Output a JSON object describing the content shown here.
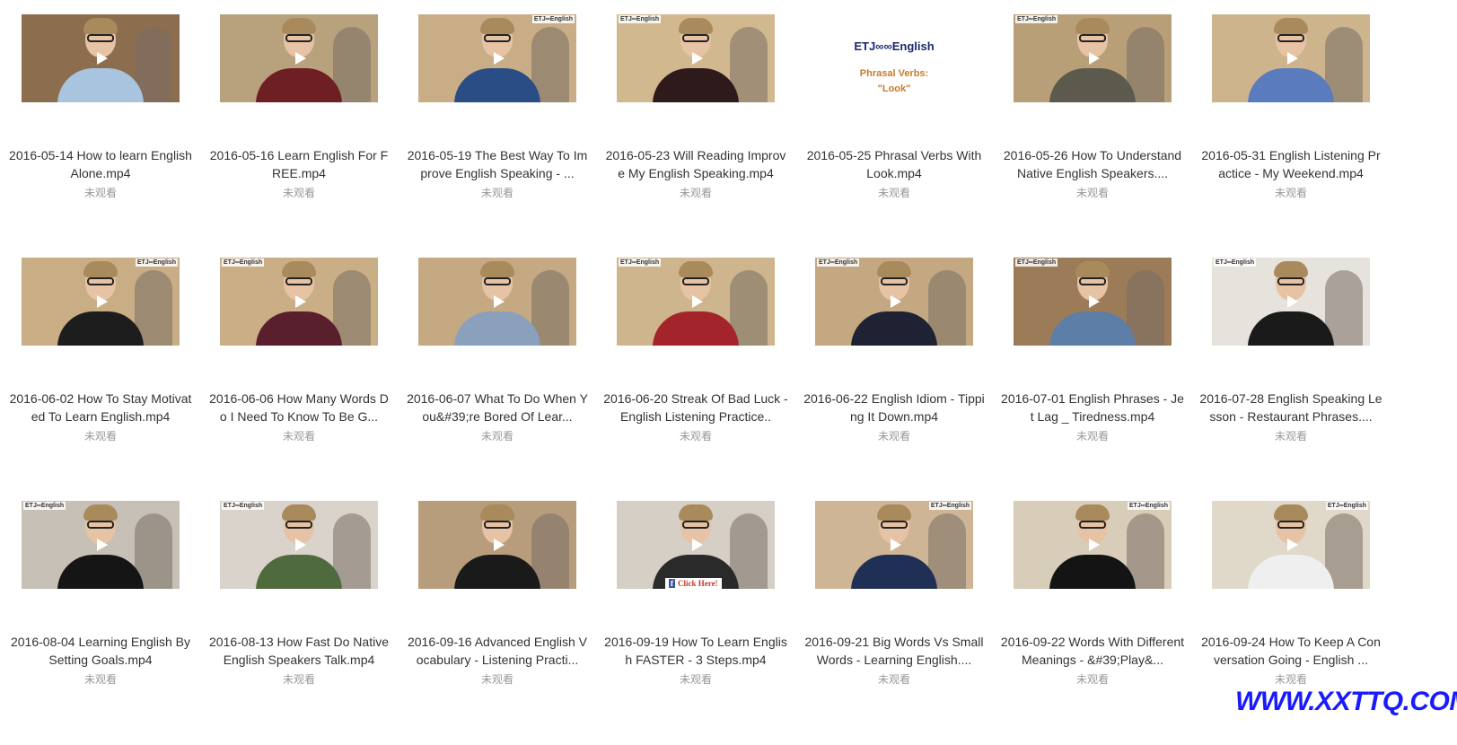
{
  "unwatched_label": "未观看",
  "thumb_logo_text": "ETJ∞English",
  "title_card": {
    "logo": "ETJ∞∞English",
    "subtitle": "Phrasal Verbs:\n\"Look\""
  },
  "facebook_badge": {
    "icon": "f",
    "text": "Click Here!"
  },
  "watermark": "WWW.XXTTQ.COM",
  "videos": [
    {
      "title": "2016-05-14 How to learn English Alone.mp4",
      "status": "未观看",
      "wall": "#8c6e4f",
      "shirt": "#a9c4de",
      "logo": ""
    },
    {
      "title": "2016-05-16 Learn English For FREE.mp4",
      "status": "未观看",
      "wall": "#b8a27d",
      "shirt": "#6e1f24",
      "logo": ""
    },
    {
      "title": "2016-05-19 The Best Way To Improve English Speaking - ...",
      "status": "未观看",
      "wall": "#c9ad86",
      "shirt": "#2b4d86",
      "logo": "r"
    },
    {
      "title": "2016-05-23 Will Reading Improve My English Speaking.mp4",
      "status": "未观看",
      "wall": "#d2b88f",
      "shirt": "#2e1a1a",
      "logo": "l"
    },
    {
      "title": "2016-05-25 Phrasal Verbs With Look.mp4",
      "status": "未观看",
      "wall": "#ffffff",
      "shirt": "#ffffff",
      "logo": "",
      "titlecard": true
    },
    {
      "title": "2016-05-26 How To Understand Native English Speakers....",
      "status": "未观看",
      "wall": "#b89f78",
      "shirt": "#5c5a4d",
      "logo": "l"
    },
    {
      "title": "2016-05-31 English Listening Practice - My Weekend.mp4",
      "status": "未观看",
      "wall": "#cdb48c",
      "shirt": "#5a7bbd",
      "logo": ""
    },
    {
      "title": "2016-06-02 How To Stay Motivated To Learn English.mp4",
      "status": "未观看",
      "wall": "#c8ad85",
      "shirt": "#1d1d1d",
      "logo": "r"
    },
    {
      "title": "2016-06-06 How Many Words Do I Need To Know To Be G...",
      "status": "未观看",
      "wall": "#c9ae86",
      "shirt": "#5a1f2c",
      "logo": "l"
    },
    {
      "title": "2016-06-07 What To Do When You&#39;re Bored Of Lear...",
      "status": "未观看",
      "wall": "#c4a982",
      "shirt": "#8aa0bd",
      "logo": ""
    },
    {
      "title": "2016-06-20 Streak Of Bad Luck - English Listening Practice..",
      "status": "未观看",
      "wall": "#cfb58d",
      "shirt": "#a3252b",
      "logo": "l"
    },
    {
      "title": "2016-06-22 English Idiom - Tipping It Down.mp4",
      "status": "未观看",
      "wall": "#c3a881",
      "shirt": "#1f2233",
      "logo": "l"
    },
    {
      "title": "2016-07-01 English Phrases - Jet Lag _ Tiredness.mp4",
      "status": "未观看",
      "wall": "#9c7c58",
      "shirt": "#5d7ea6",
      "logo": "l"
    },
    {
      "title": "2016-07-28 English Speaking Lesson - Restaurant Phrases....",
      "status": "未观看",
      "wall": "#e6e2dc",
      "shirt": "#1a1a1a",
      "logo": "l"
    },
    {
      "title": "2016-08-04 Learning English By Setting Goals.mp4",
      "status": "未观看",
      "wall": "#c7c0b6",
      "shirt": "#151515",
      "logo": "l"
    },
    {
      "title": "2016-08-13 How Fast Do Native English Speakers Talk.mp4",
      "status": "未观看",
      "wall": "#d9d3cb",
      "shirt": "#4f6a3c",
      "logo": "l"
    },
    {
      "title": "2016-09-16 Advanced English Vocabulary - Listening Practi...",
      "status": "未观看",
      "wall": "#b89d7c",
      "shirt": "#1a1a1a",
      "logo": ""
    },
    {
      "title": "2016-09-19 How To Learn English FASTER - 3 Steps.mp4",
      "status": "未观看",
      "wall": "#d5cfc6",
      "shirt": "#2a2a2a",
      "logo": "",
      "fb": true
    },
    {
      "title": "2016-09-21 Big Words Vs Small Words - Learning English....",
      "status": "未观看",
      "wall": "#cdb596",
      "shirt": "#1f2f55",
      "logo": "r"
    },
    {
      "title": "2016-09-22 Words With Different Meanings - &#39;Play&...",
      "status": "未观看",
      "wall": "#d8cdb9",
      "shirt": "#141414",
      "logo": "r"
    },
    {
      "title": "2016-09-24 How To Keep A Conversation Going - English ...",
      "status": "未观看",
      "wall": "#e0d8c8",
      "shirt": "#efefef",
      "logo": "r"
    }
  ]
}
